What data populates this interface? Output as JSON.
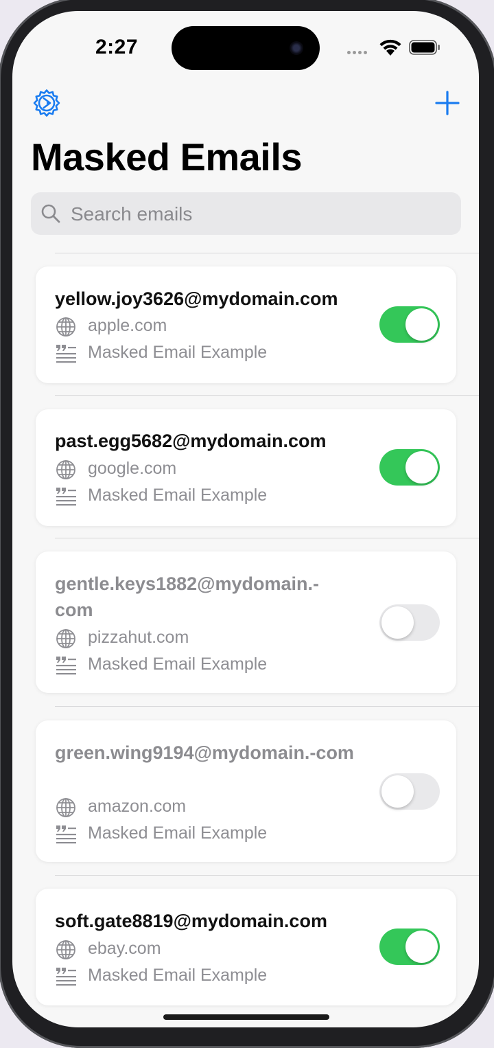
{
  "status_bar": {
    "time": "2:27"
  },
  "header": {
    "settings_icon": "gear-icon",
    "add_icon": "plus-icon",
    "title": "Masked Emails",
    "accent_color": "#1a7cf0"
  },
  "search": {
    "placeholder": "Search emails",
    "value": ""
  },
  "emails": [
    {
      "address": "yellow.joy3626@mydomain.com",
      "domain": "apple.com",
      "description": "Masked Email Example",
      "enabled": true
    },
    {
      "address": "past.egg5682@mydomain.com",
      "domain": "google.com",
      "description": "Masked Email Example",
      "enabled": true
    },
    {
      "address": "gentle.keys1882@mydomain.-com",
      "domain": "pizzahut.com",
      "description": "Masked Email Example",
      "enabled": false
    },
    {
      "address": "green.wing9194@mydomain.-com",
      "domain": "amazon.com",
      "description": "Masked Email Example",
      "enabled": false
    },
    {
      "address": "soft.gate8819@mydomain.com",
      "domain": "ebay.com",
      "description": "Masked Email Example",
      "enabled": true
    }
  ],
  "icons": {
    "domain": "globe-icon",
    "description": "quote-text-icon"
  },
  "colors": {
    "toggle_on": "#34c759",
    "toggle_off": "#e9e9eb"
  }
}
